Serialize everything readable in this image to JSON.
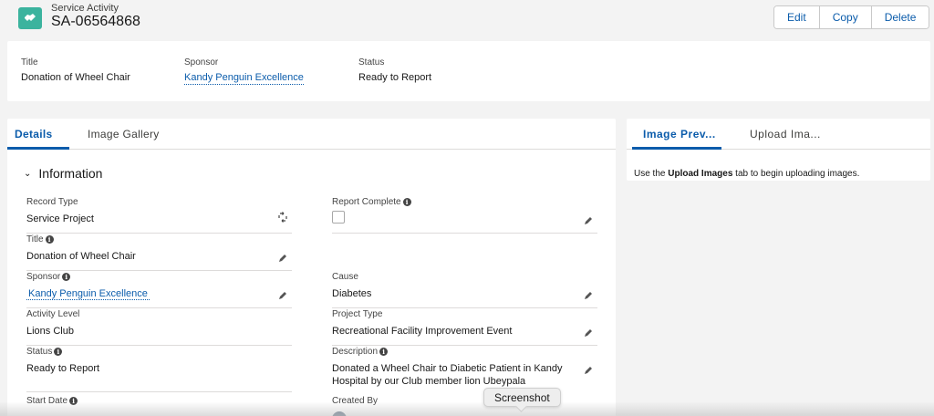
{
  "header": {
    "object_label": "Service Activity",
    "record_name": "SA-06564868",
    "icon": "handshake-icon",
    "actions": {
      "edit": "Edit",
      "copy": "Copy",
      "delete": "Delete"
    }
  },
  "highlights": {
    "title_label": "Title",
    "title_value": "Donation of Wheel Chair",
    "sponsor_label": "Sponsor",
    "sponsor_value": "Kandy Penguin Excellence",
    "status_label": "Status",
    "status_value": "Ready to Report"
  },
  "main": {
    "tabs": [
      "Details",
      "Image Gallery"
    ],
    "section_title": "Information",
    "fields": {
      "record_type": {
        "label": "Record Type",
        "value": "Service Project"
      },
      "report_complete": {
        "label": "Report Complete",
        "checked": false
      },
      "title": {
        "label": "Title",
        "value": "Donation of Wheel Chair"
      },
      "sponsor": {
        "label": "Sponsor",
        "value": "Kandy Penguin Excellence"
      },
      "cause": {
        "label": "Cause",
        "value": "Diabetes"
      },
      "activity_level": {
        "label": "Activity Level",
        "value": "Lions Club"
      },
      "project_type": {
        "label": "Project Type",
        "value": "Recreational Facility Improvement Event"
      },
      "status": {
        "label": "Status",
        "value": "Ready to Report"
      },
      "description": {
        "label": "Description",
        "value": "Donated a Wheel Chair to Diabetic Patient in Kandy Hospital by our Club member lion Ubeypala"
      },
      "start_date": {
        "label": "Start Date",
        "value": ""
      },
      "created_by": {
        "label": "Created By",
        "value": ""
      }
    }
  },
  "side": {
    "tabs": [
      "Image Prev...",
      "Upload Ima..."
    ],
    "message_prefix": "Use the ",
    "message_bold": "Upload Images",
    "message_suffix": " tab to begin uploading images."
  },
  "tooltip": {
    "text": "Screenshot"
  },
  "colors": {
    "brand": "#0b5cab",
    "object_icon": "#3bb39e",
    "background": "#f3f3f3"
  }
}
